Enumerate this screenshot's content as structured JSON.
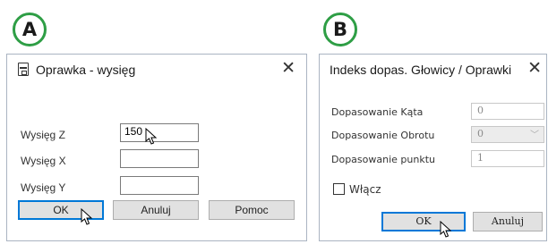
{
  "badges": {
    "a": "A",
    "b": "B"
  },
  "dialog_a": {
    "title": "Oprawka - wysięg",
    "close": "✕",
    "fields": [
      {
        "label": "Wysięg Z",
        "value": "150"
      },
      {
        "label": "Wysięg X",
        "value": ""
      },
      {
        "label": "Wysięg Y",
        "value": ""
      }
    ],
    "buttons": {
      "ok": "OK",
      "cancel": "Anuluj",
      "help": "Pomoc"
    }
  },
  "dialog_b": {
    "title": "Indeks dopas. Głowicy / Oprawki",
    "close": "✕",
    "fields": [
      {
        "label": "Dopasowanie Kąta",
        "value": "0"
      },
      {
        "label": "Dopasowanie Obrotu",
        "value": "0"
      },
      {
        "label": "Dopasowanie punktu",
        "value": "1"
      }
    ],
    "checkbox_label": "Włącz",
    "checkbox_checked": false,
    "buttons": {
      "ok": "OK",
      "cancel": "Anuluj"
    }
  },
  "colors": {
    "badge_border": "#2e9e45",
    "default_button_border": "#0078d7"
  }
}
